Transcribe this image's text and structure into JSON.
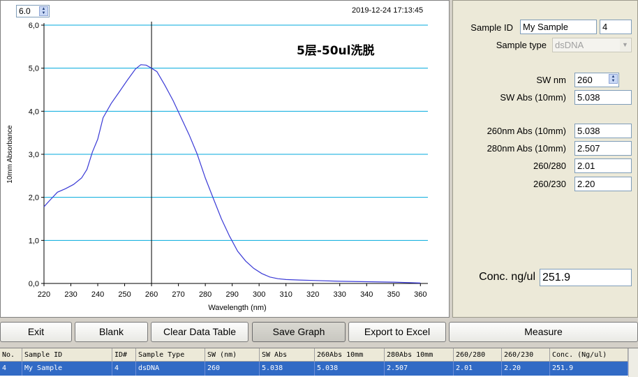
{
  "chart": {
    "ymax_value": "6.0",
    "timestamp": "2019-12-24 17:13:45",
    "annotation": "5层-50ul洗脱",
    "colors": {
      "grid": "#00aadd",
      "curve": "#3a3ad6",
      "cursor": "#000000"
    }
  },
  "chart_data": {
    "type": "line",
    "title": "5层-50ul洗脱",
    "xlabel": "Wavelength (nm)",
    "ylabel": "10mm Absorbance",
    "xlim": [
      220,
      362
    ],
    "ylim": [
      0,
      6
    ],
    "x_ticks": [
      "220",
      "230",
      "240",
      "250",
      "260",
      "270",
      "280",
      "290",
      "300",
      "310",
      "320",
      "330",
      "340",
      "350",
      "360"
    ],
    "y_ticks": [
      "0,0",
      "1,0",
      "2,0",
      "3,0",
      "4,0",
      "5,0",
      "6,0"
    ],
    "cursor_x": 260,
    "grid": "horizontal",
    "series": [
      {
        "x": [
          220,
          222,
          225,
          228,
          231,
          234,
          236,
          238,
          240,
          242,
          245,
          248,
          251,
          254,
          256,
          258,
          260,
          262,
          265,
          268,
          271,
          274,
          277,
          280,
          283,
          286,
          289,
          292,
          295,
          298,
          301,
          304,
          307,
          310,
          315,
          320,
          330,
          340,
          350,
          360
        ],
        "y": [
          1.78,
          1.92,
          2.12,
          2.2,
          2.3,
          2.45,
          2.65,
          3.05,
          3.35,
          3.85,
          4.18,
          4.45,
          4.72,
          4.98,
          5.08,
          5.07,
          5.0,
          4.92,
          4.6,
          4.25,
          3.85,
          3.45,
          3.0,
          2.45,
          1.97,
          1.5,
          1.1,
          0.75,
          0.52,
          0.35,
          0.23,
          0.15,
          0.11,
          0.09,
          0.08,
          0.07,
          0.05,
          0.04,
          0.03,
          0.01
        ]
      }
    ]
  },
  "sample": {
    "sample_id_label": "Sample ID",
    "sample_id_value": "My Sample",
    "id_number": "4",
    "sample_type_label": "Sample type",
    "sample_type_value": "dsDNA",
    "sw_nm_label": "SW nm",
    "sw_nm_value": "260",
    "sw_abs_label": "SW Abs (10mm)",
    "sw_abs_value": "5.038",
    "abs260_label": "260nm Abs (10mm)",
    "abs260_value": "5.038",
    "abs280_label": "280nm Abs (10mm)",
    "abs280_value": "2.507",
    "ratio260_280_label": "260/280",
    "ratio260_280_value": "2.01",
    "ratio260_230_label": "260/230",
    "ratio260_230_value": "2.20",
    "conc_label": "Conc. ng/ul",
    "conc_value": "251.9"
  },
  "toolbar": {
    "exit": "Exit",
    "blank": "Blank",
    "clear": "Clear Data Table",
    "save_graph": "Save Graph",
    "export": "Export to Excel",
    "measure": "Measure"
  },
  "table": {
    "headers": [
      "No.",
      "Sample ID",
      "ID#",
      "Sample Type",
      "SW (nm)",
      "SW Abs",
      "260Abs 10mm",
      "280Abs 10mm",
      "260/280",
      "260/230",
      "Conc. (Ng/ul)"
    ],
    "rows": [
      [
        "4",
        "My Sample",
        "4",
        "dsDNA",
        "260",
        "5.038",
        "5.038",
        "2.507",
        "2.01",
        "2.20",
        "251.9"
      ]
    ]
  }
}
